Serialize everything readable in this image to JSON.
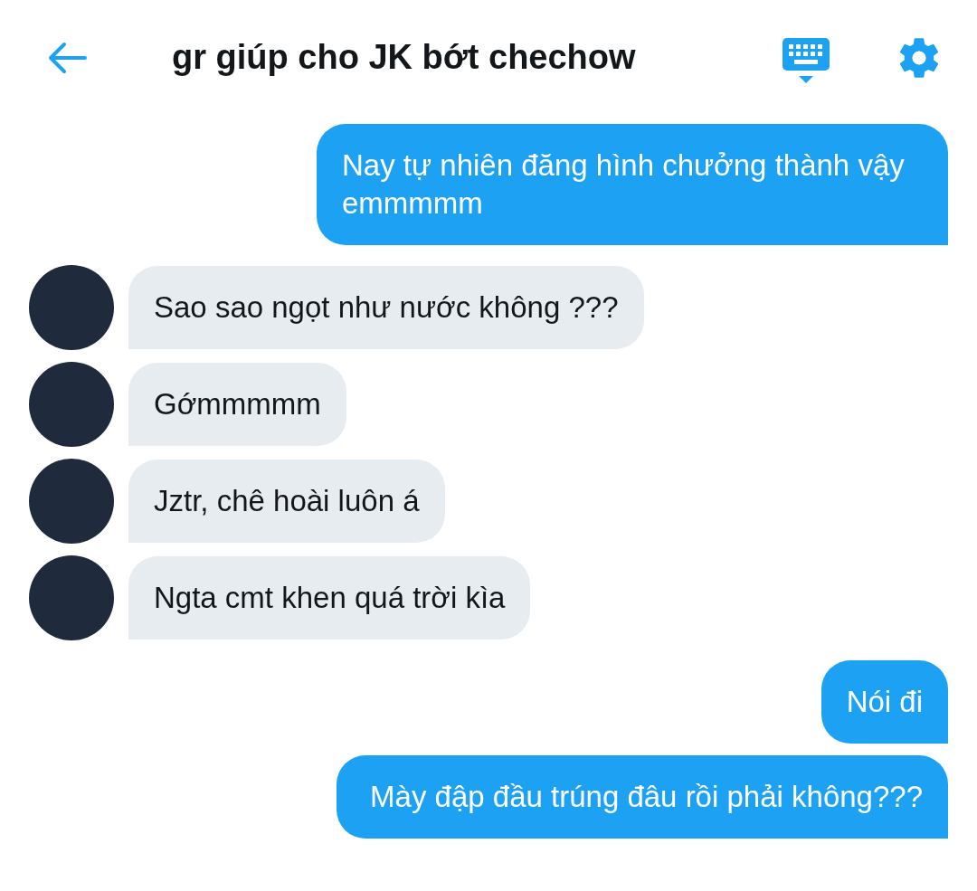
{
  "header": {
    "title": "gr giúp cho JK bớt chechow"
  },
  "messages": [
    {
      "kind": "sent",
      "text": "Nay tự nhiên đăng hình chưởng thành vậy emmmmm"
    },
    {
      "kind": "received",
      "text": "Sao sao ngọt như nước không ???"
    },
    {
      "kind": "received",
      "text": "Gớmmmmm"
    },
    {
      "kind": "received",
      "text": "Jztr, chê hoài luôn á"
    },
    {
      "kind": "received",
      "text": "Ngta cmt khen quá trời kìa"
    },
    {
      "kind": "sent",
      "text": "Nói đi"
    },
    {
      "kind": "sent",
      "text": " Mày đập đầu trúng đâu rồi phải không???"
    }
  ]
}
